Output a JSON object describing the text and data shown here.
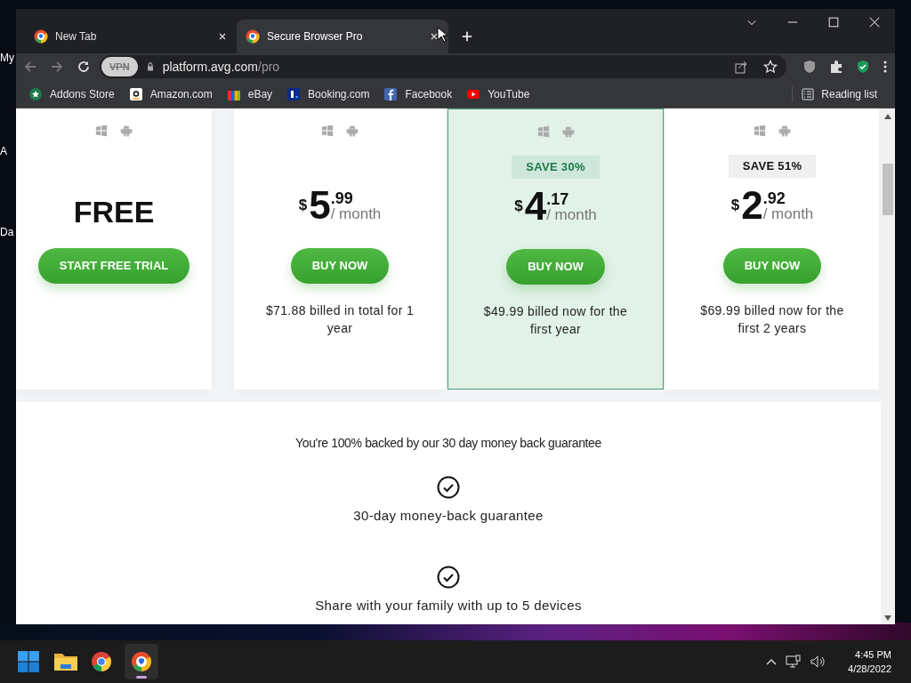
{
  "desktop_icons": [
    {
      "label": "My"
    },
    {
      "label": "A"
    },
    {
      "label": "Da"
    }
  ],
  "tabs": [
    {
      "title": "New Tab",
      "selected": false
    },
    {
      "title": "Secure Browser Pro",
      "selected": true
    }
  ],
  "address": {
    "host": "platform.avg.com",
    "path": "/pro",
    "vpn": "VPN"
  },
  "bookmarks": [
    {
      "label": "Addons Store"
    },
    {
      "label": "Amazon.com"
    },
    {
      "label": "eBay"
    },
    {
      "label": "Booking.com"
    },
    {
      "label": "Facebook"
    },
    {
      "label": "YouTube"
    }
  ],
  "reading_list": "Reading list",
  "plans": [
    {
      "kind": "free",
      "price": "FREE",
      "button": "START FREE TRIAL",
      "selected": false
    },
    {
      "kind": "paid",
      "currency": "$",
      "whole": "5",
      "cents": ".99",
      "period": "/ month",
      "button": "BUY NOW",
      "note": "$71.88 billed in total for 1 year",
      "selected": false
    },
    {
      "kind": "paid",
      "badge": "SAVE 30%",
      "currency": "$",
      "whole": "4",
      "cents": ".17",
      "period": "/ month",
      "button": "BUY NOW",
      "note": "$49.99 billed now for the first year",
      "selected": true
    },
    {
      "kind": "paid",
      "badge": "SAVE 51%",
      "currency": "$",
      "whole": "2",
      "cents": ".92",
      "period": "/ month",
      "button": "BUY NOW",
      "note": "$69.99 billed now for the first 2 years",
      "selected": false
    }
  ],
  "guarantee": {
    "heading": "You're 100% backed by our 30 day money back guarantee",
    "features": [
      "30-day money-back guarantee",
      "Share with your family with up to 5 devices"
    ]
  },
  "taskbar": {
    "time": "4:45 PM",
    "date": "4/28/2022"
  }
}
